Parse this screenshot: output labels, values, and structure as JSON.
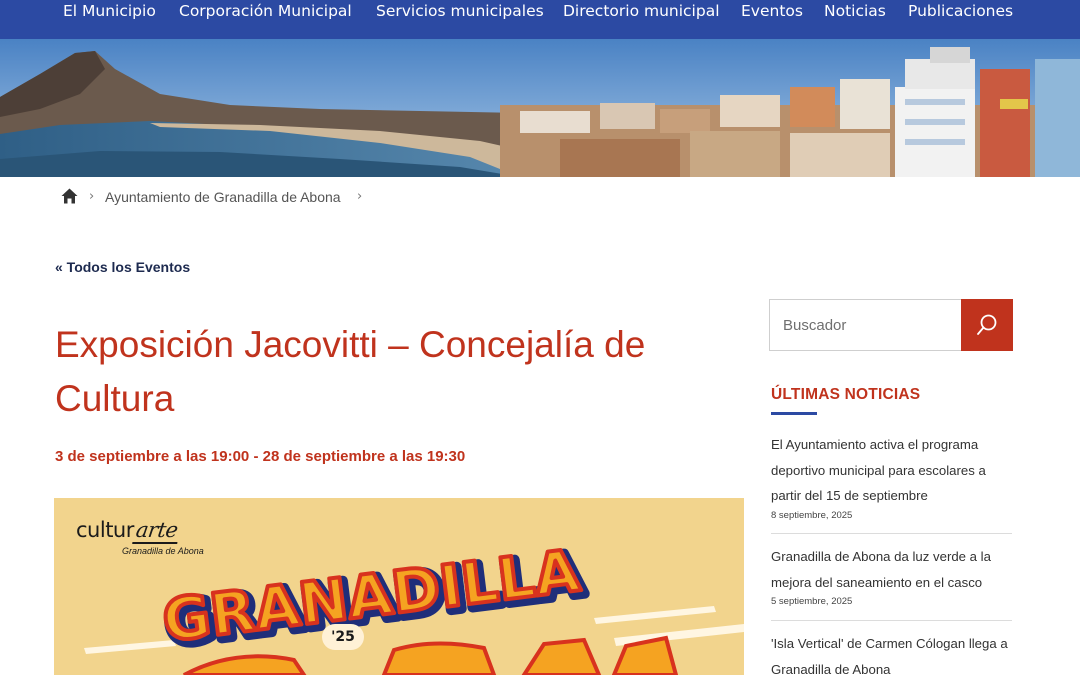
{
  "nav": {
    "items": [
      {
        "label": "El Municipio"
      },
      {
        "label": "Corporación Municipal"
      },
      {
        "label": "Servicios municipales"
      },
      {
        "label": "Directorio municipal"
      },
      {
        "label": "Eventos"
      },
      {
        "label": "Noticias"
      },
      {
        "label": "Publicaciones"
      }
    ]
  },
  "breadcrumb": {
    "home_icon": "home-icon",
    "separator": "›",
    "items": [
      {
        "label": "Ayuntamiento de Granadilla de Abona"
      }
    ]
  },
  "event": {
    "back_link": "« Todos los Eventos",
    "title": "Exposición Jacovitti – Concejalía de Cultura",
    "date": "3 de septiembre a las 19:00 - 28 de septiembre a las 19:30",
    "poster": {
      "logo_prefix": "cultur",
      "logo_suffix": "arte",
      "logo_sub": "Granadilla de Abona",
      "headline": "GRANADILLA",
      "year": "'25",
      "partial_word": "COMIC"
    }
  },
  "sidebar": {
    "search": {
      "placeholder": "Buscador",
      "value": "",
      "button_icon": "search-icon"
    },
    "news_heading": "ÚLTIMAS NOTICIAS",
    "news": [
      {
        "title": "El Ayuntamiento activa el programa deportivo municipal para escolares a partir del 15 de septiembre",
        "date": "8 septiembre, 2025"
      },
      {
        "title": "Granadilla de Abona da luz verde a la mejora del saneamiento en el casco",
        "date": "5 septiembre, 2025"
      },
      {
        "title": "'Isla Vertical' de Carmen Cólogan llega a Granadilla de Abona",
        "date": ""
      }
    ]
  },
  "colors": {
    "nav_bg": "#2c4aa3",
    "accent_red": "#c0331d",
    "link_dark": "#1d2a4f"
  }
}
